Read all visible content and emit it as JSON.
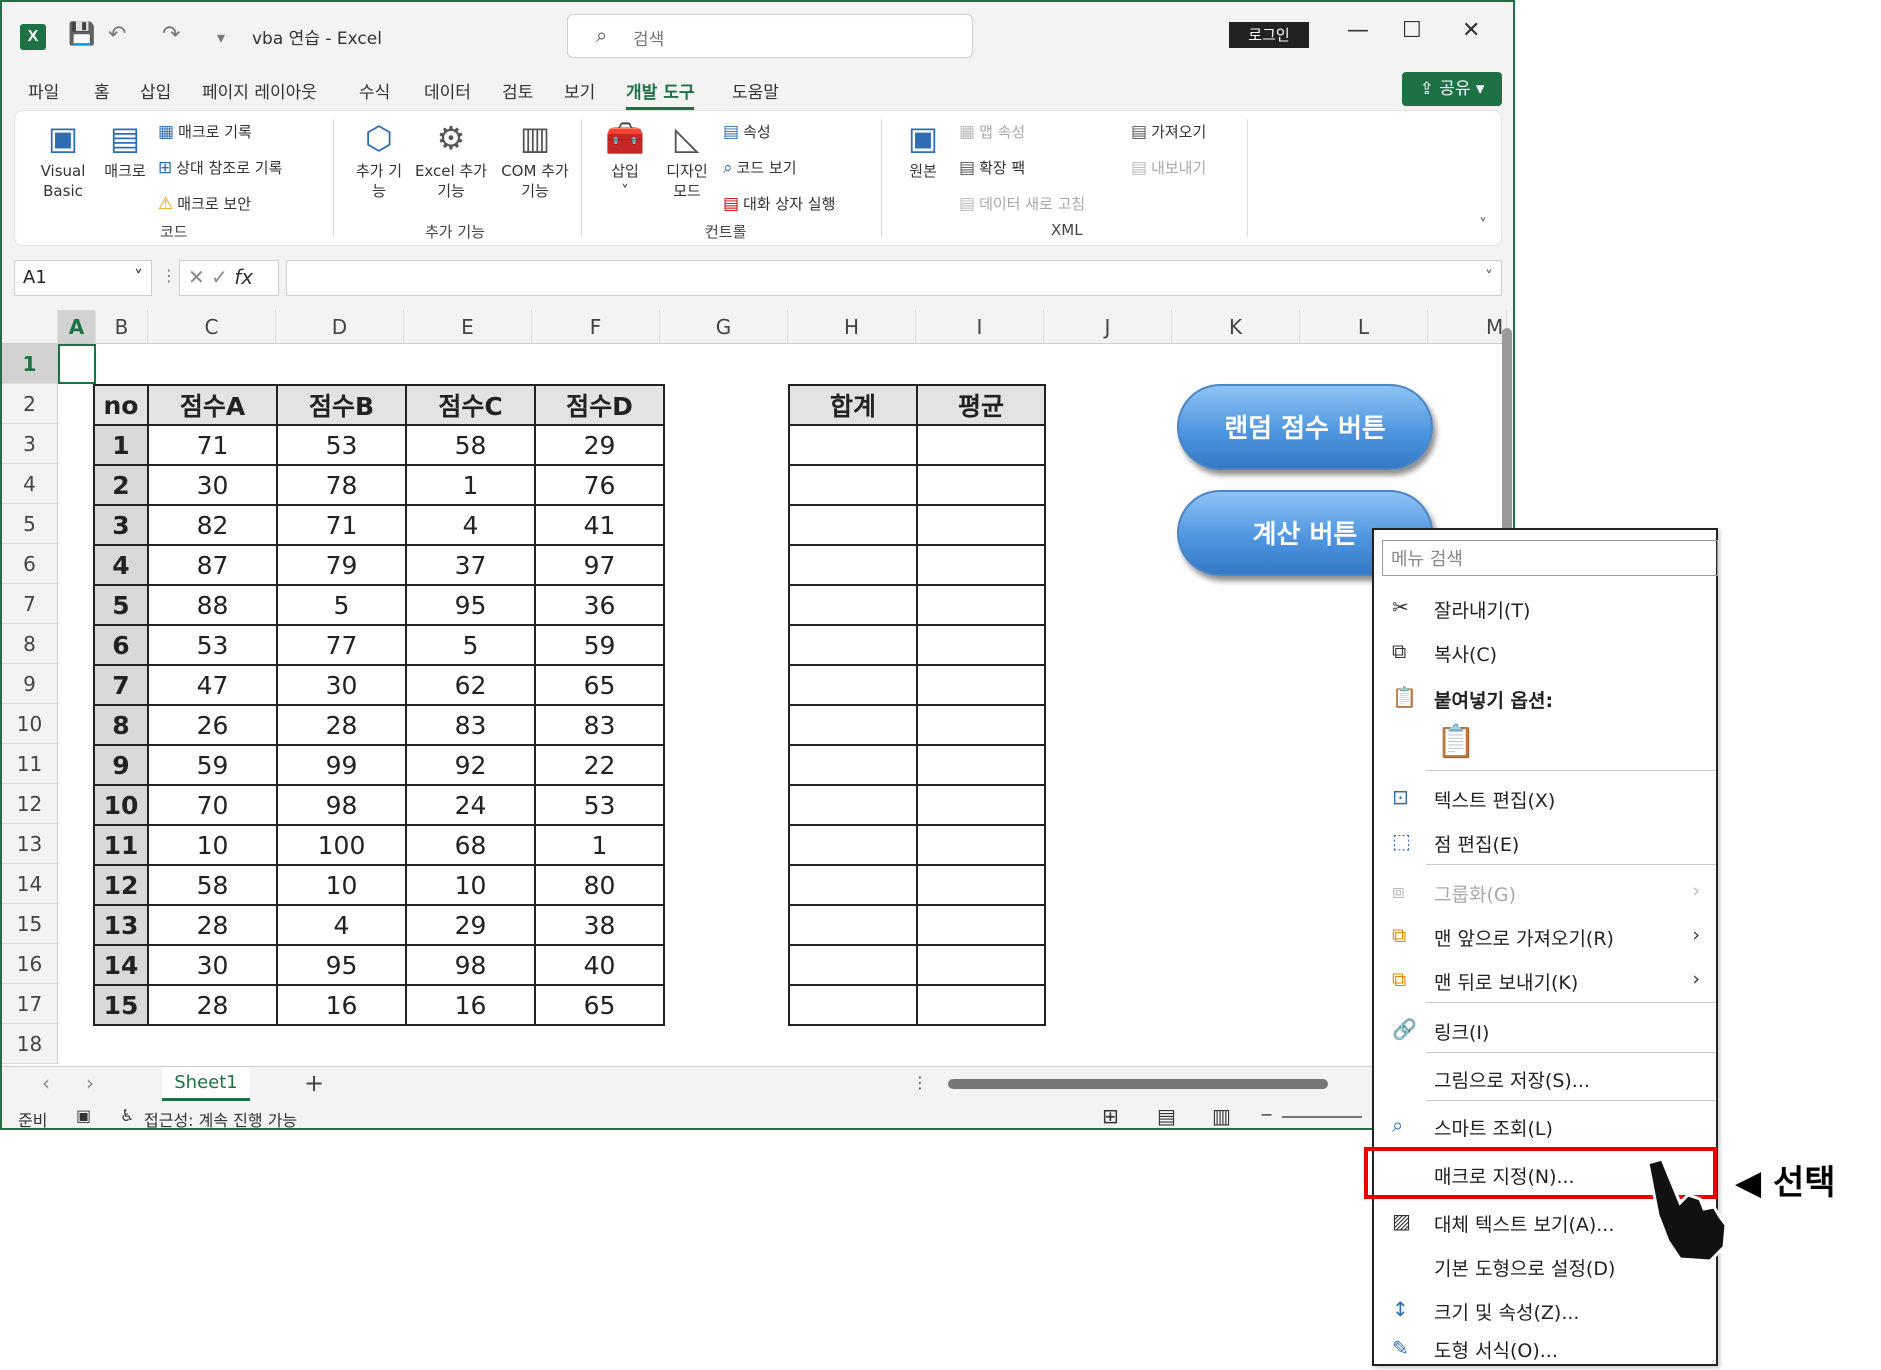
{
  "window": {
    "title": "vba 연습  -  Excel",
    "search_placeholder": "검색",
    "login": "로그인",
    "share": "공유"
  },
  "menu": [
    "파일",
    "홈",
    "삽입",
    "페이지 레이아웃",
    "수식",
    "데이터",
    "검토",
    "보기",
    "개발 도구",
    "도움말"
  ],
  "ribbon": {
    "code": {
      "visual_basic": "Visual Basic",
      "macro": "매크로",
      "record_macro": "매크로 기록",
      "relative_ref": "상대 참조로 기록",
      "macro_security": "매크로 보안",
      "group": "코드"
    },
    "addins": {
      "addin": "추가 기능",
      "excel_addin": "Excel 추가 기능",
      "com_addin": "COM 추가 기능",
      "group": "추가 기능"
    },
    "controls": {
      "insert": "삽입",
      "design_mode": "디자인 모드",
      "properties": "속성",
      "view_code": "코드 보기",
      "run_dialog": "대화 상자 실행",
      "group": "컨트롤"
    },
    "xml": {
      "source": "원본",
      "map_properties": "맵 속성",
      "expansion_packs": "확장 팩",
      "refresh_data": "데이터 새로 고침",
      "import": "가져오기",
      "export": "내보내기",
      "group": "XML"
    }
  },
  "formula_bar": {
    "name_box": "A1",
    "fx": "fx"
  },
  "columns": [
    "A",
    "B",
    "C",
    "D",
    "E",
    "F",
    "G",
    "H",
    "I",
    "J",
    "K",
    "L",
    "M"
  ],
  "rows": [
    "1",
    "2",
    "3",
    "4",
    "5",
    "6",
    "7",
    "8",
    "9",
    "10",
    "11",
    "12",
    "13",
    "14",
    "15",
    "16",
    "17",
    "18"
  ],
  "score_table": {
    "headers": [
      "no",
      "점수A",
      "점수B",
      "점수C",
      "점수D"
    ],
    "rows": [
      [
        "1",
        "71",
        "53",
        "58",
        "29"
      ],
      [
        "2",
        "30",
        "78",
        "1",
        "76"
      ],
      [
        "3",
        "82",
        "71",
        "4",
        "41"
      ],
      [
        "4",
        "87",
        "79",
        "37",
        "97"
      ],
      [
        "5",
        "88",
        "5",
        "95",
        "36"
      ],
      [
        "6",
        "53",
        "77",
        "5",
        "59"
      ],
      [
        "7",
        "47",
        "30",
        "62",
        "65"
      ],
      [
        "8",
        "26",
        "28",
        "83",
        "83"
      ],
      [
        "9",
        "59",
        "99",
        "92",
        "22"
      ],
      [
        "10",
        "70",
        "98",
        "24",
        "53"
      ],
      [
        "11",
        "10",
        "100",
        "68",
        "1"
      ],
      [
        "12",
        "58",
        "10",
        "10",
        "80"
      ],
      [
        "13",
        "28",
        "4",
        "29",
        "38"
      ],
      [
        "14",
        "30",
        "95",
        "98",
        "40"
      ],
      [
        "15",
        "28",
        "16",
        "16",
        "65"
      ]
    ]
  },
  "sum_table": {
    "headers": [
      "합계",
      "평균"
    ]
  },
  "buttons": {
    "random": "랜덤 점수 버튼",
    "calc": "계산 버튼"
  },
  "sheet_tab": "Sheet1",
  "status": {
    "ready": "준비",
    "accessibility": "접근성: 계속 진행 가능"
  },
  "context_menu": {
    "search_placeholder": "메뉴 검색",
    "items": {
      "cut": "잘라내기(T)",
      "copy": "복사(C)",
      "paste_options": "붙여넣기 옵션:",
      "edit_text": "텍스트 편집(X)",
      "edit_points": "점 편집(E)",
      "group": "그룹화(G)",
      "bring_front": "맨 앞으로 가져오기(R)",
      "send_back": "맨 뒤로 보내기(K)",
      "link": "링크(I)",
      "save_picture": "그림으로 저장(S)...",
      "smart_lookup": "스마트 조회(L)",
      "assign_macro": "매크로 지정(N)...",
      "alt_text": "대체 텍스트 보기(A)...",
      "set_default": "기본 도형으로 설정(D)",
      "size_props": "크기 및 속성(Z)...",
      "format_shape": "도형 서식(O)..."
    }
  },
  "annotation": "◀ 선택",
  "colors": {
    "excel_green": "#1e7145",
    "highlight": "#e00000",
    "button_blue": "#4f96e0"
  }
}
